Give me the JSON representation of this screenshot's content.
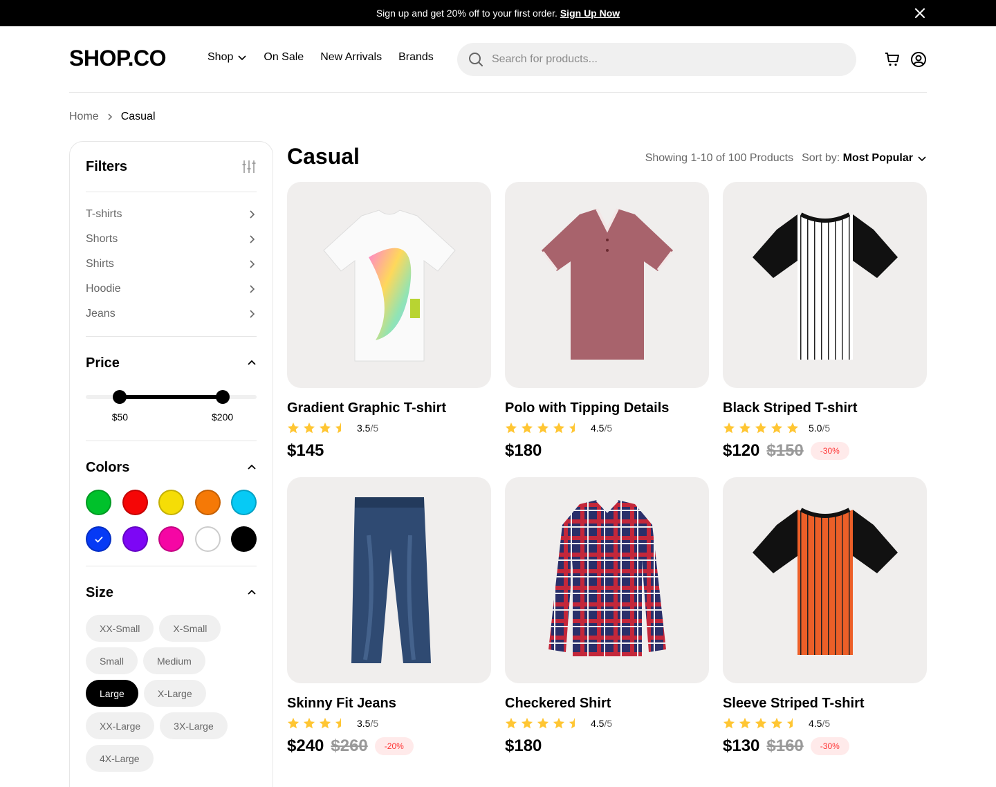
{
  "banner": {
    "text": "Sign up and get 20% off to your first order.",
    "link": "Sign Up Now"
  },
  "header": {
    "logo": "SHOP.CO",
    "nav": [
      "Shop",
      "On Sale",
      "New Arrivals",
      "Brands"
    ],
    "search_placeholder": "Search for products..."
  },
  "breadcrumb": {
    "home": "Home",
    "current": "Casual"
  },
  "filters": {
    "title": "Filters",
    "categories": [
      "T-shirts",
      "Shorts",
      "Shirts",
      "Hoodie",
      "Jeans"
    ],
    "price": {
      "title": "Price",
      "min_label": "$50",
      "max_label": "$200",
      "min_fraction": 0.2,
      "max_fraction": 0.8
    },
    "colors": {
      "title": "Colors",
      "swatches": [
        "#00c12b",
        "#f50606",
        "#f5dd06",
        "#f57906",
        "#06caf5",
        "#063af5",
        "#7d06f5",
        "#f506a4",
        "#ffffff",
        "#000000"
      ],
      "selected_index": 5
    },
    "size": {
      "title": "Size",
      "options": [
        "XX-Small",
        "X-Small",
        "Small",
        "Medium",
        "Large",
        "X-Large",
        "XX-Large",
        "3X-Large",
        "4X-Large"
      ],
      "selected": "Large"
    }
  },
  "main": {
    "title": "Casual",
    "showing": "Showing 1-10 of 100 Products",
    "sort_label": "Sort by:",
    "sort_value": "Most Popular"
  },
  "products": [
    {
      "name": "Gradient Graphic T-shirt",
      "rating": 3.5,
      "rating_text": "3.5",
      "price": "$145",
      "old_price": "",
      "discount": ""
    },
    {
      "name": "Polo with Tipping Details",
      "rating": 4.5,
      "rating_text": "4.5",
      "price": "$180",
      "old_price": "",
      "discount": ""
    },
    {
      "name": "Black Striped T-shirt",
      "rating": 5.0,
      "rating_text": "5.0",
      "price": "$120",
      "old_price": "$150",
      "discount": "-30%"
    },
    {
      "name": "Skinny Fit Jeans",
      "rating": 3.5,
      "rating_text": "3.5",
      "price": "$240",
      "old_price": "$260",
      "discount": "-20%"
    },
    {
      "name": "Checkered Shirt",
      "rating": 4.5,
      "rating_text": "4.5",
      "price": "$180",
      "old_price": "",
      "discount": ""
    },
    {
      "name": "Sleeve Striped T-shirt",
      "rating": 4.5,
      "rating_text": "4.5",
      "price": "$130",
      "old_price": "$160",
      "discount": "-30%"
    }
  ],
  "rating_max": "/5",
  "colors": {
    "star": "#ffc633",
    "discount": "#ff3333"
  }
}
